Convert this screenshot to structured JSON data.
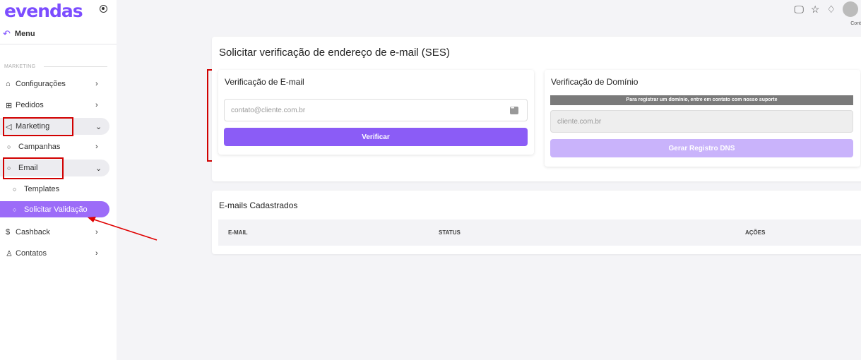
{
  "brand": {
    "logo_text": "evendas",
    "accent": "#8b5cf6"
  },
  "sidebar": {
    "menu_label": "Menu",
    "section_label": "MARKETING",
    "items": [
      {
        "label": "Configurações",
        "icon": "home-gear-icon"
      },
      {
        "label": "Pedidos",
        "icon": "cart-icon"
      },
      {
        "label": "Marketing",
        "icon": "megaphone-icon"
      },
      {
        "label": "Campanhas",
        "icon": "circle-bullet-icon"
      },
      {
        "label": "Email",
        "icon": "circle-bullet-icon"
      },
      {
        "label": "Templates",
        "icon": "circle-bullet-icon"
      },
      {
        "label": "Solicitar Validação",
        "icon": "circle-bullet-icon"
      },
      {
        "label": "Cashback",
        "icon": "dollar-circle-icon"
      },
      {
        "label": "Contatos",
        "icon": "users-icon"
      }
    ]
  },
  "header": {
    "user_label": "Cont"
  },
  "main": {
    "title": "Solicitar verificação de endereço de e-mail (SES)",
    "email_card": {
      "title": "Verificação de E-mail",
      "placeholder": "contato@cliente.com.br",
      "button": "Verificar"
    },
    "domain_card": {
      "title": "Verificação de Domínio",
      "notice": "Para registrar um domínio, entre em contato com nosso suporte",
      "placeholder": "cliente.com.br",
      "button": "Gerar Registro DNS"
    },
    "list": {
      "title": "E-mails Cadastrados",
      "columns": [
        "E-MAIL",
        "STATUS",
        "AÇÕES"
      ]
    }
  }
}
